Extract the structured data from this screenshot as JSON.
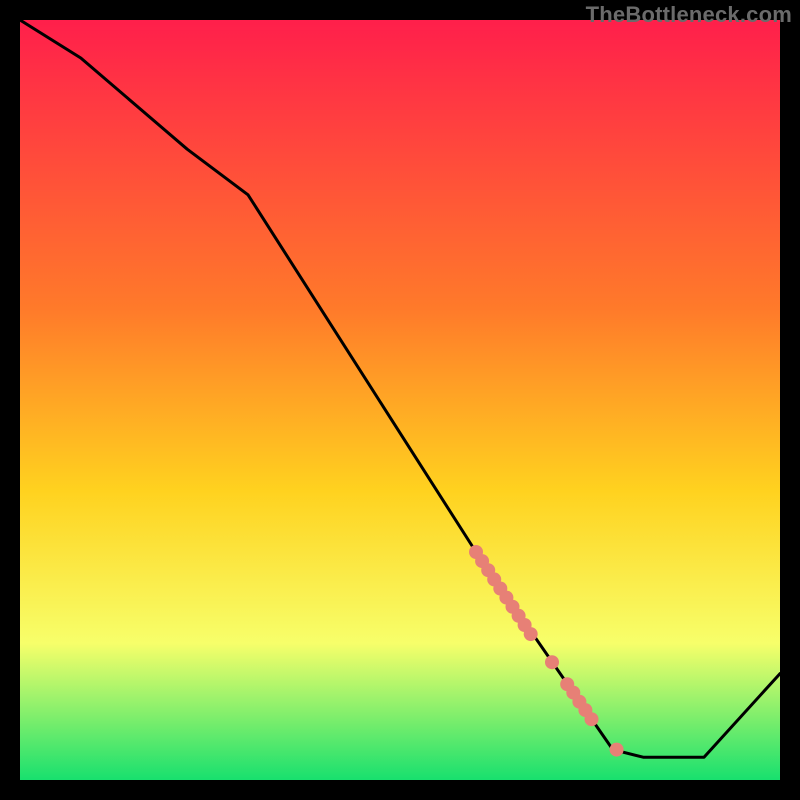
{
  "watermark": "TheBottleneck.com",
  "colors": {
    "gradient_top": "#ff1f4b",
    "gradient_mid1": "#ff7a2a",
    "gradient_mid2": "#ffd21f",
    "gradient_mid3": "#f7ff6a",
    "gradient_bottom": "#18e06e",
    "line": "#000000",
    "marker": "#e78076",
    "frame": "#000000"
  },
  "chart_data": {
    "type": "line",
    "title": "",
    "xlabel": "",
    "ylabel": "",
    "xlim": [
      0,
      100
    ],
    "ylim": [
      0,
      100
    ],
    "grid": false,
    "legend": false,
    "series": [
      {
        "name": "curve",
        "x": [
          0,
          8,
          22,
          30,
          60,
          78,
          82,
          90,
          100
        ],
        "y": [
          100,
          95,
          83,
          77,
          30,
          4,
          3,
          3,
          14
        ]
      }
    ],
    "markers": [
      {
        "x": 60.0,
        "y": 30.0
      },
      {
        "x": 60.8,
        "y": 28.8
      },
      {
        "x": 61.6,
        "y": 27.6
      },
      {
        "x": 62.4,
        "y": 26.4
      },
      {
        "x": 63.2,
        "y": 25.2
      },
      {
        "x": 64.0,
        "y": 24.0
      },
      {
        "x": 64.8,
        "y": 22.8
      },
      {
        "x": 65.6,
        "y": 21.6
      },
      {
        "x": 66.4,
        "y": 20.4
      },
      {
        "x": 67.2,
        "y": 19.2
      },
      {
        "x": 70.0,
        "y": 15.5
      },
      {
        "x": 72.0,
        "y": 12.6
      },
      {
        "x": 72.8,
        "y": 11.5
      },
      {
        "x": 73.6,
        "y": 10.3
      },
      {
        "x": 74.4,
        "y": 9.2
      },
      {
        "x": 75.2,
        "y": 8.0
      },
      {
        "x": 78.5,
        "y": 4.0
      }
    ]
  }
}
